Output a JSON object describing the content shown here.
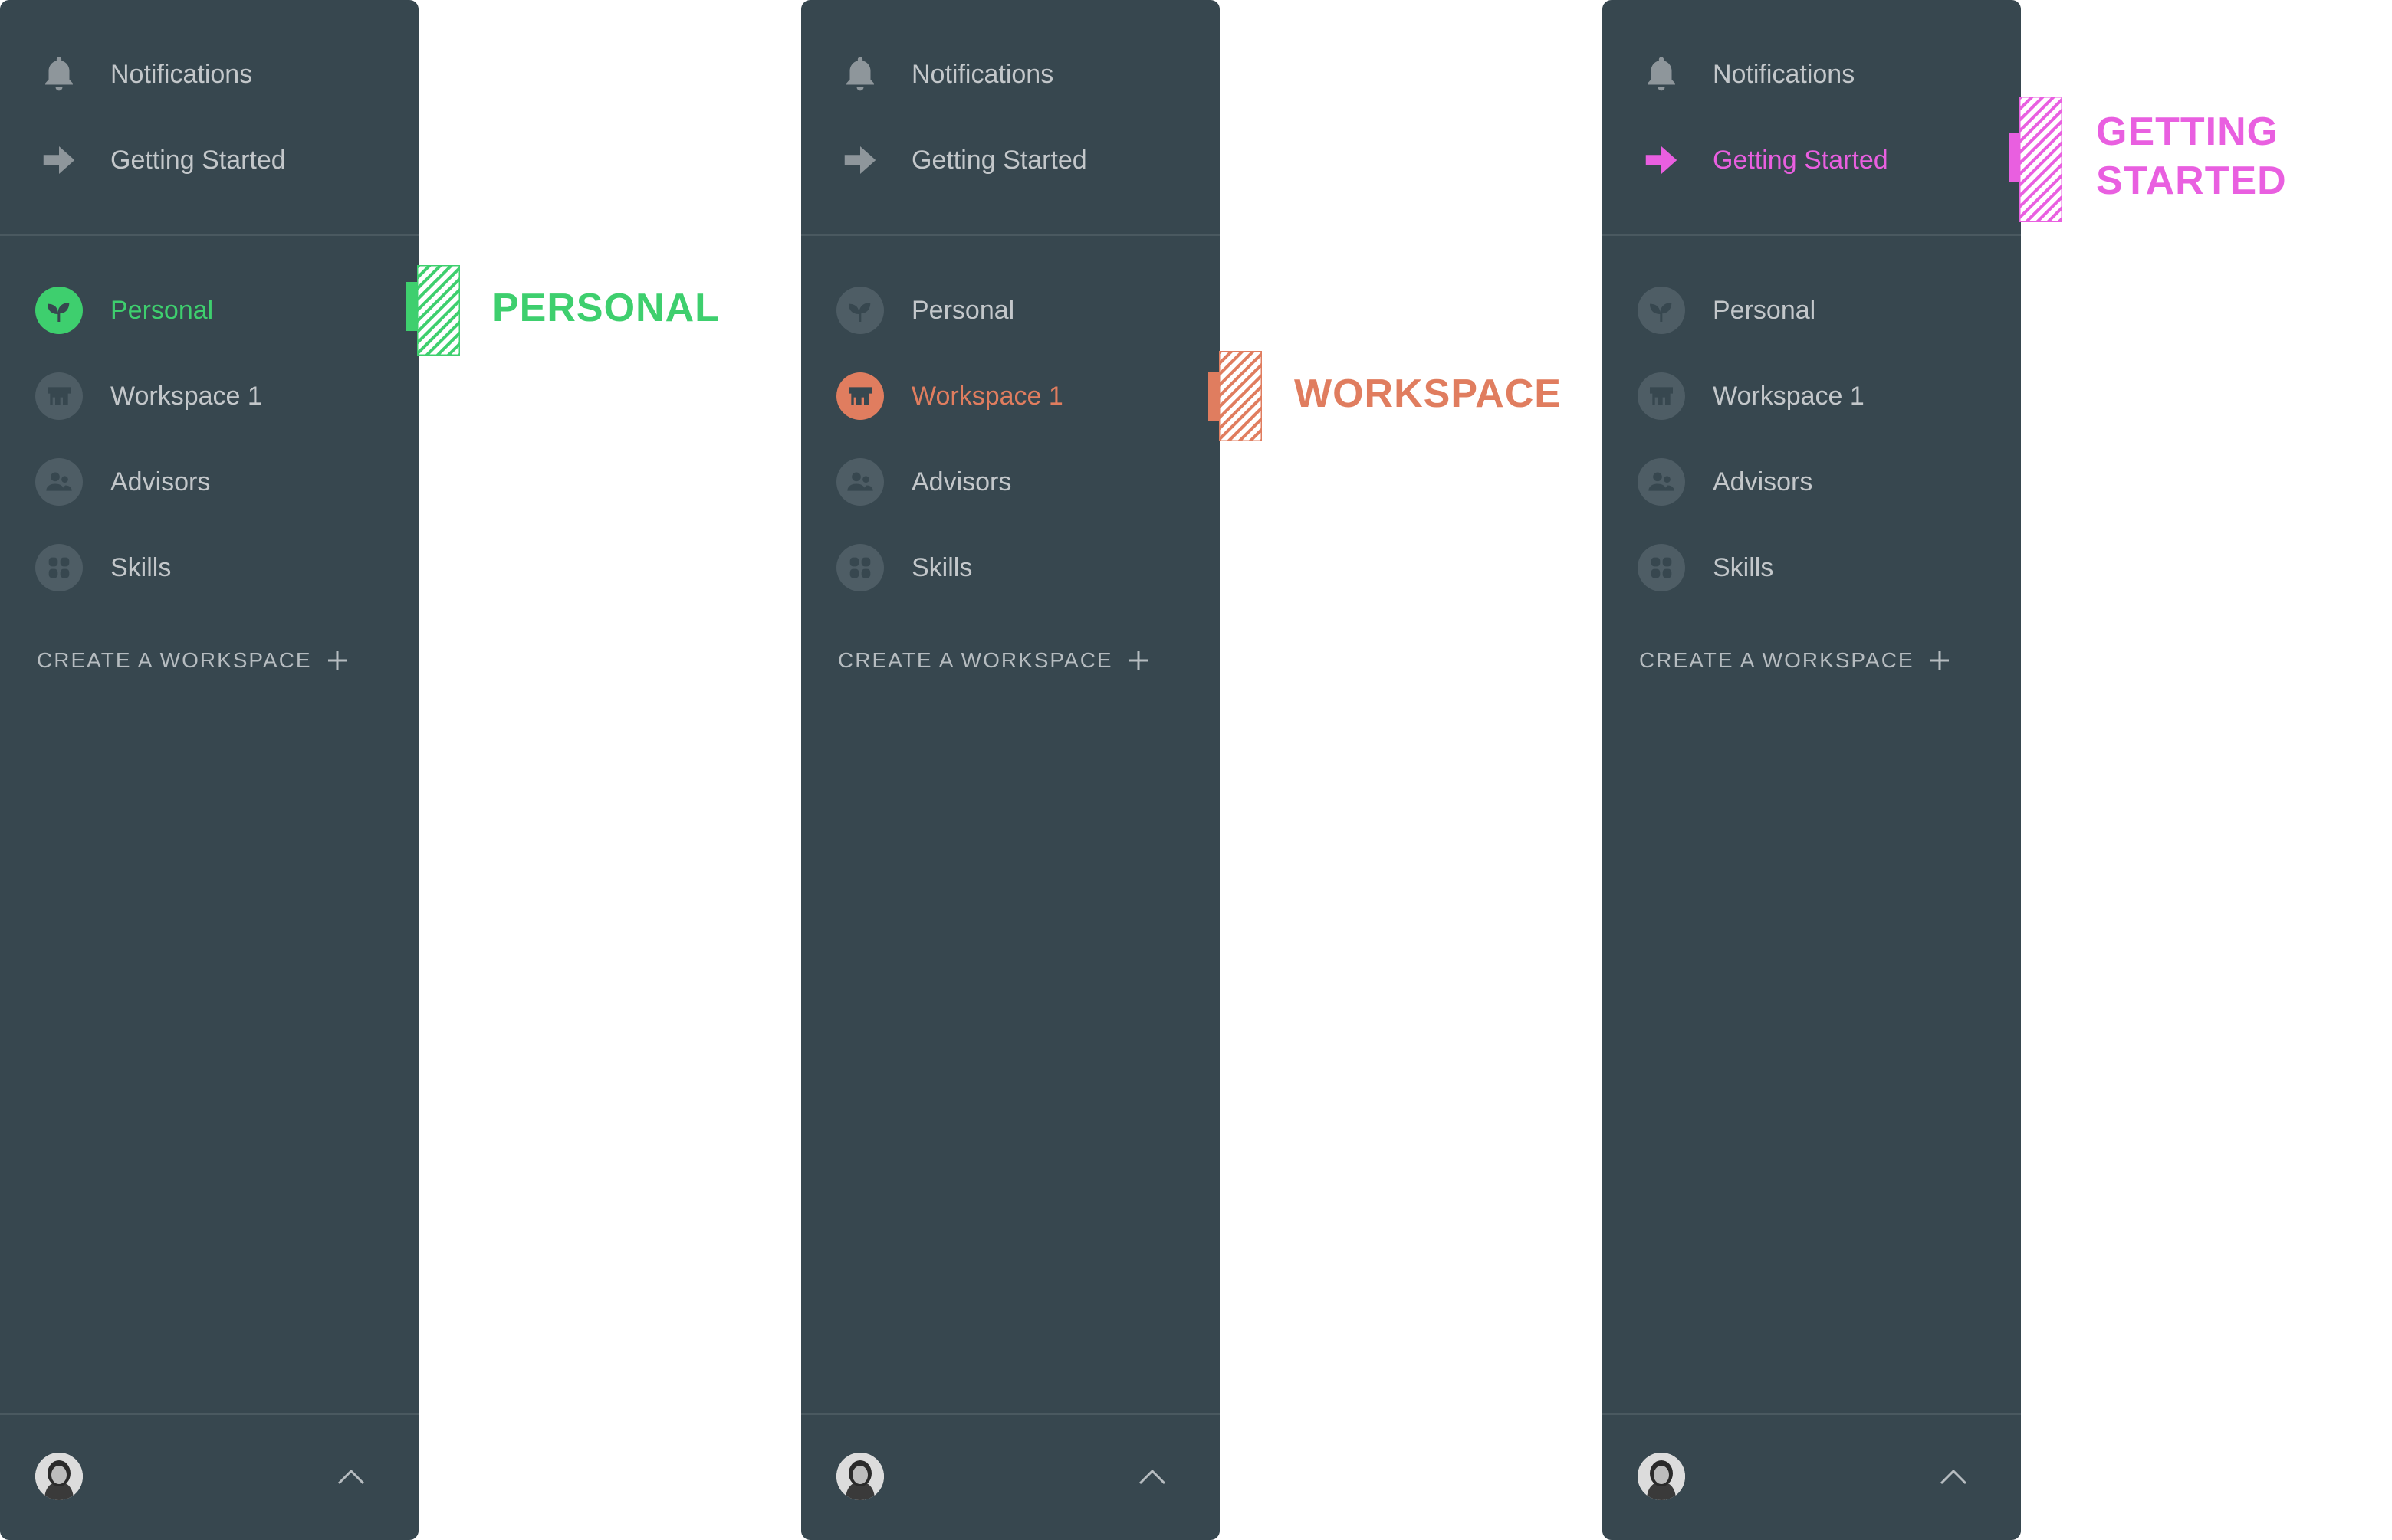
{
  "colors": {
    "panel_bg": "#37474f",
    "text_muted": "#c3c7ca",
    "personal_accent": "#3ecf6e",
    "workspace_accent": "#e07d5f",
    "getting_started_accent": "#e95fe0"
  },
  "sidebars": [
    {
      "notifications": "Notifications",
      "getting_started": "Getting Started",
      "workspaces": [
        "Personal",
        "Workspace 1",
        "Advisors",
        "Skills"
      ],
      "create_workspace": "CREATE A WORKSPACE",
      "active_item": "Personal",
      "callout": "PERSONAL"
    },
    {
      "notifications": "Notifications",
      "getting_started": "Getting Started",
      "workspaces": [
        "Personal",
        "Workspace 1",
        "Advisors",
        "Skills"
      ],
      "create_workspace": "CREATE A WORKSPACE",
      "active_item": "Workspace 1",
      "callout": "WORKSPACE"
    },
    {
      "notifications": "Notifications",
      "getting_started": "Getting Started",
      "workspaces": [
        "Personal",
        "Workspace 1",
        "Advisors",
        "Skills"
      ],
      "create_workspace": "CREATE A WORKSPACE",
      "active_item": "Getting Started",
      "callout": "GETTING\nSTARTED"
    }
  ],
  "icons": {
    "notifications": "bell-icon",
    "getting_started": "arrow-right-icon",
    "personal": "sprout-icon",
    "workspace": "building-icon",
    "advisors": "people-icon",
    "skills": "grid-icon",
    "create": "plus-icon",
    "expand": "chevron-up-icon"
  }
}
